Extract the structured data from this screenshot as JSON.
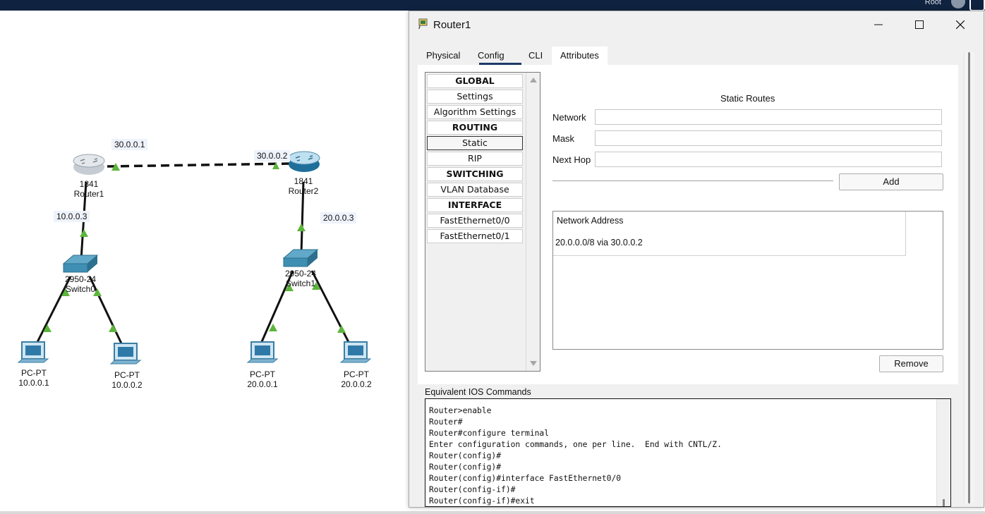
{
  "taskbar": {
    "user": "Root"
  },
  "topology": {
    "ip_labels": {
      "r1_link": "30.0.0.1",
      "r2_link": "30.0.0.2",
      "r1_lan": "10.0.0.3",
      "r2_lan": "20.0.0.3"
    },
    "router1": {
      "model": "1841",
      "name": "Router1"
    },
    "router2": {
      "model": "1841",
      "name": "Router2"
    },
    "switch0": {
      "model": "2950-24",
      "name": "Switch0"
    },
    "switch1": {
      "model": "2950-24",
      "name": "Switch1"
    },
    "pcs": [
      {
        "type": "PC-PT",
        "ip": "10.0.0.1"
      },
      {
        "type": "PC-PT",
        "ip": "10.0.0.2"
      },
      {
        "type": "PC-PT",
        "ip": "20.0.0.1"
      },
      {
        "type": "PC-PT",
        "ip": "20.0.0.2"
      }
    ]
  },
  "window": {
    "title": "Router1",
    "tabs": [
      "Physical",
      "Config",
      "CLI",
      "Attributes"
    ],
    "active_tab": "Config",
    "left_menu": [
      "GLOBAL",
      "Settings",
      "Algorithm Settings",
      "ROUTING",
      "Static",
      "RIP",
      "SWITCHING",
      "VLAN Database",
      "INTERFACE",
      "FastEthernet0/0",
      "FastEthernet0/1"
    ],
    "selected_menu": "Static",
    "static_routes": {
      "title": "Static Routes",
      "network_label": "Network",
      "mask_label": "Mask",
      "nexthop_label": "Next Hop",
      "network_value": "",
      "mask_value": "",
      "nexthop_value": "",
      "add_button": "Add",
      "list_header": "Network Address",
      "routes": [
        "20.0.0.0/8 via 30.0.0.2"
      ],
      "remove_button": "Remove"
    },
    "ios": {
      "label": "Equivalent IOS Commands",
      "lines": [
        "Router>enable",
        "Router#",
        "Router#configure terminal",
        "Enter configuration commands, one per line.  End with CNTL/Z.",
        "Router(config)#",
        "Router(config)#",
        "Router(config)#interface FastEthernet0/0",
        "Router(config-if)#",
        "Router(config-if)#exit"
      ]
    }
  },
  "colors": {
    "taskbar": "#0f2340",
    "link_green": "#5db53b",
    "tab_underline": "#1c3a66",
    "device_blue": "#3f8fb3"
  }
}
